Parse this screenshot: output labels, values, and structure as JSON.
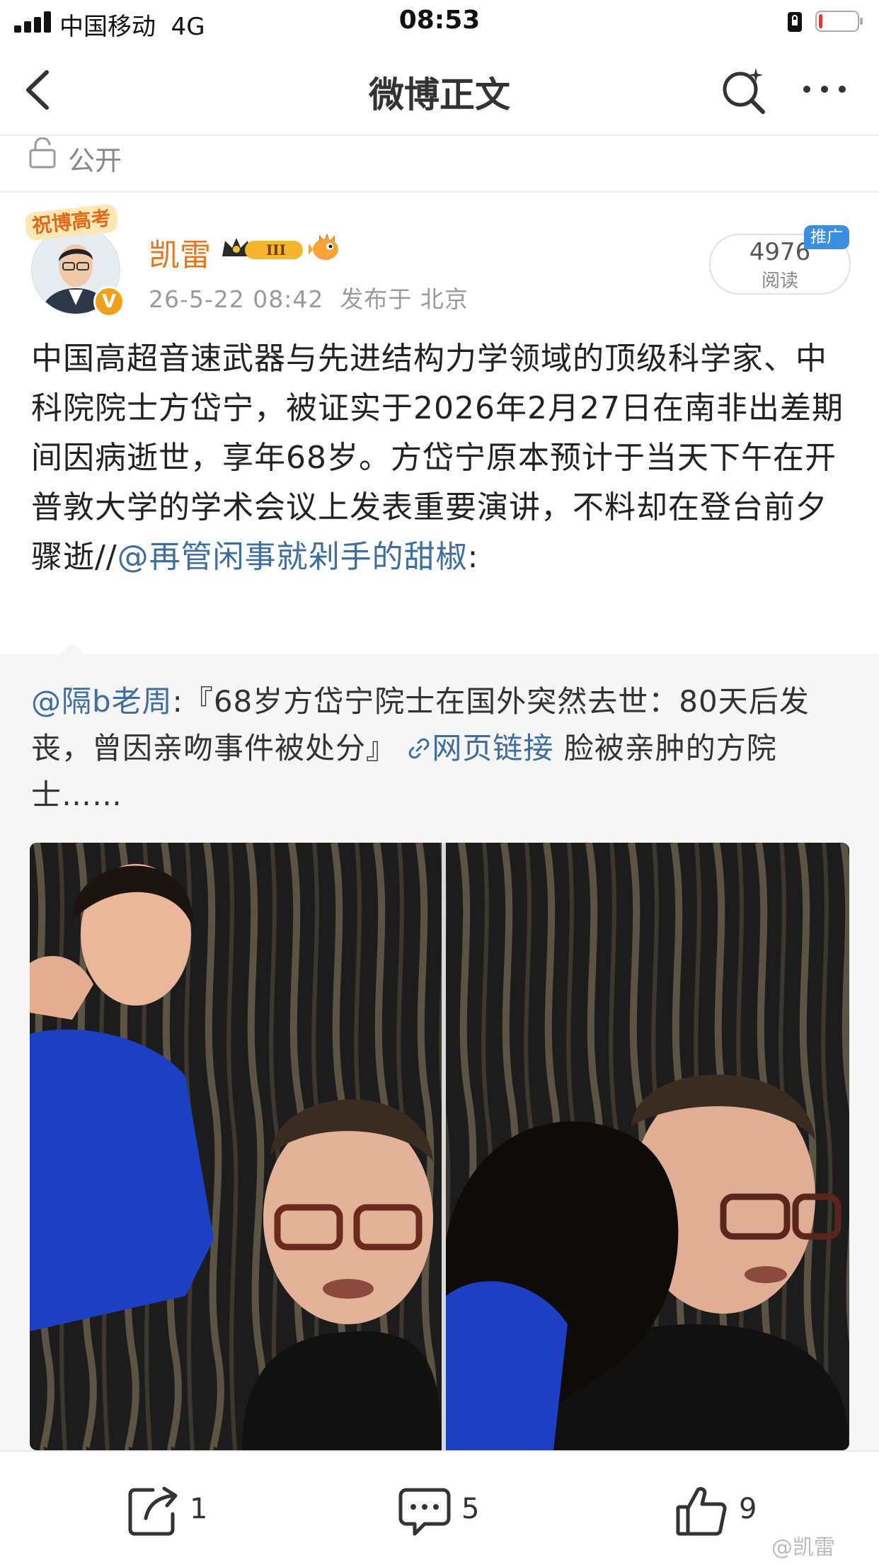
{
  "status_bar": {
    "carrier": "中国移动",
    "network": "4G",
    "time": "08:53",
    "battery_level": 0.1
  },
  "nav": {
    "title": "微博正文"
  },
  "privacy": {
    "label": "公开"
  },
  "post": {
    "avatar_badge": "祝博高考",
    "author": "凯雷",
    "rank": "III",
    "timestamp": "26-5-22 08:42",
    "location_prefix": "发布于",
    "location": "北京",
    "read_count": "4976",
    "read_label": "阅读",
    "promo_tag": "推广",
    "body_text": "中国高超音速武器与先进结构力学领域的顶级科学家、中科院院士方岱宁，被证实于2026年2月27日在南非出差期间因病逝世，享年68岁。方岱宁原本预计于当天下午在开普敦大学的学术会议上发表重要演讲，不料却在登台前夕骤逝//",
    "mention": "@再管闲事就剁手的甜椒",
    "mention_suffix": ":"
  },
  "repost": {
    "author_mention": "@隔b老周",
    "text": ":『68岁方岱宁院士在国外突然去世：80天后发丧，曾因亲吻事件被处分』",
    "link_label": "网页链接",
    "tail_text": " 脸被亲肿的方院士……"
  },
  "toolbar": {
    "share_count": "1",
    "comment_count": "5",
    "like_count": "9"
  },
  "watermark": "@凯雷",
  "colors": {
    "link_blue": "#3f6d9e",
    "name_orange": "#e6761e",
    "promo_blue": "#3a8fe0"
  }
}
